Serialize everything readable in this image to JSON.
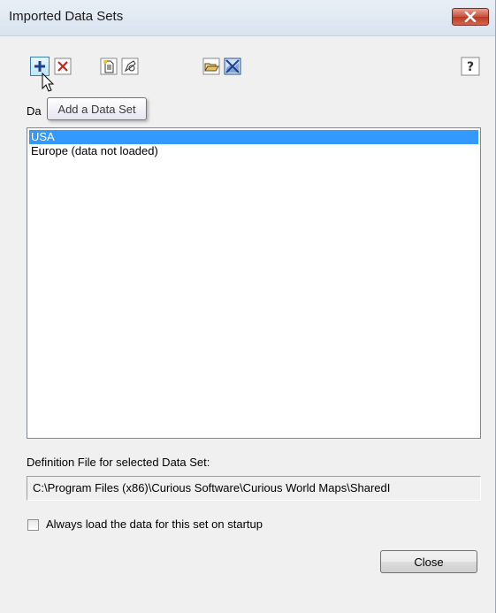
{
  "window": {
    "title": "Imported Data Sets"
  },
  "toolbar": {
    "buttons": [
      {
        "icon": "add-icon",
        "tooltip": "Add a Data Set"
      },
      {
        "icon": "delete-icon"
      },
      {
        "icon": "new-document-icon"
      },
      {
        "icon": "edit-document-icon"
      },
      {
        "icon": "open-folder-icon"
      },
      {
        "icon": "unload-icon"
      },
      {
        "icon": "help-icon"
      }
    ]
  },
  "tooltip": {
    "text": "Add a Data Set"
  },
  "list": {
    "label_partial": "Da",
    "items": [
      {
        "label": "USA",
        "selected": true
      },
      {
        "label": "Europe (data not loaded)",
        "selected": false
      }
    ]
  },
  "definition": {
    "label": "Definition File for selected Data Set:",
    "path": "C:\\Program Files (x86)\\Curious Software\\Curious World Maps\\SharedI"
  },
  "options": {
    "always_load_label": "Always load the data for this set on startup",
    "always_load_checked": false
  },
  "footer": {
    "close_label": "Close"
  },
  "colors": {
    "selection": "#3399ff",
    "close_button": "#c8503b"
  }
}
